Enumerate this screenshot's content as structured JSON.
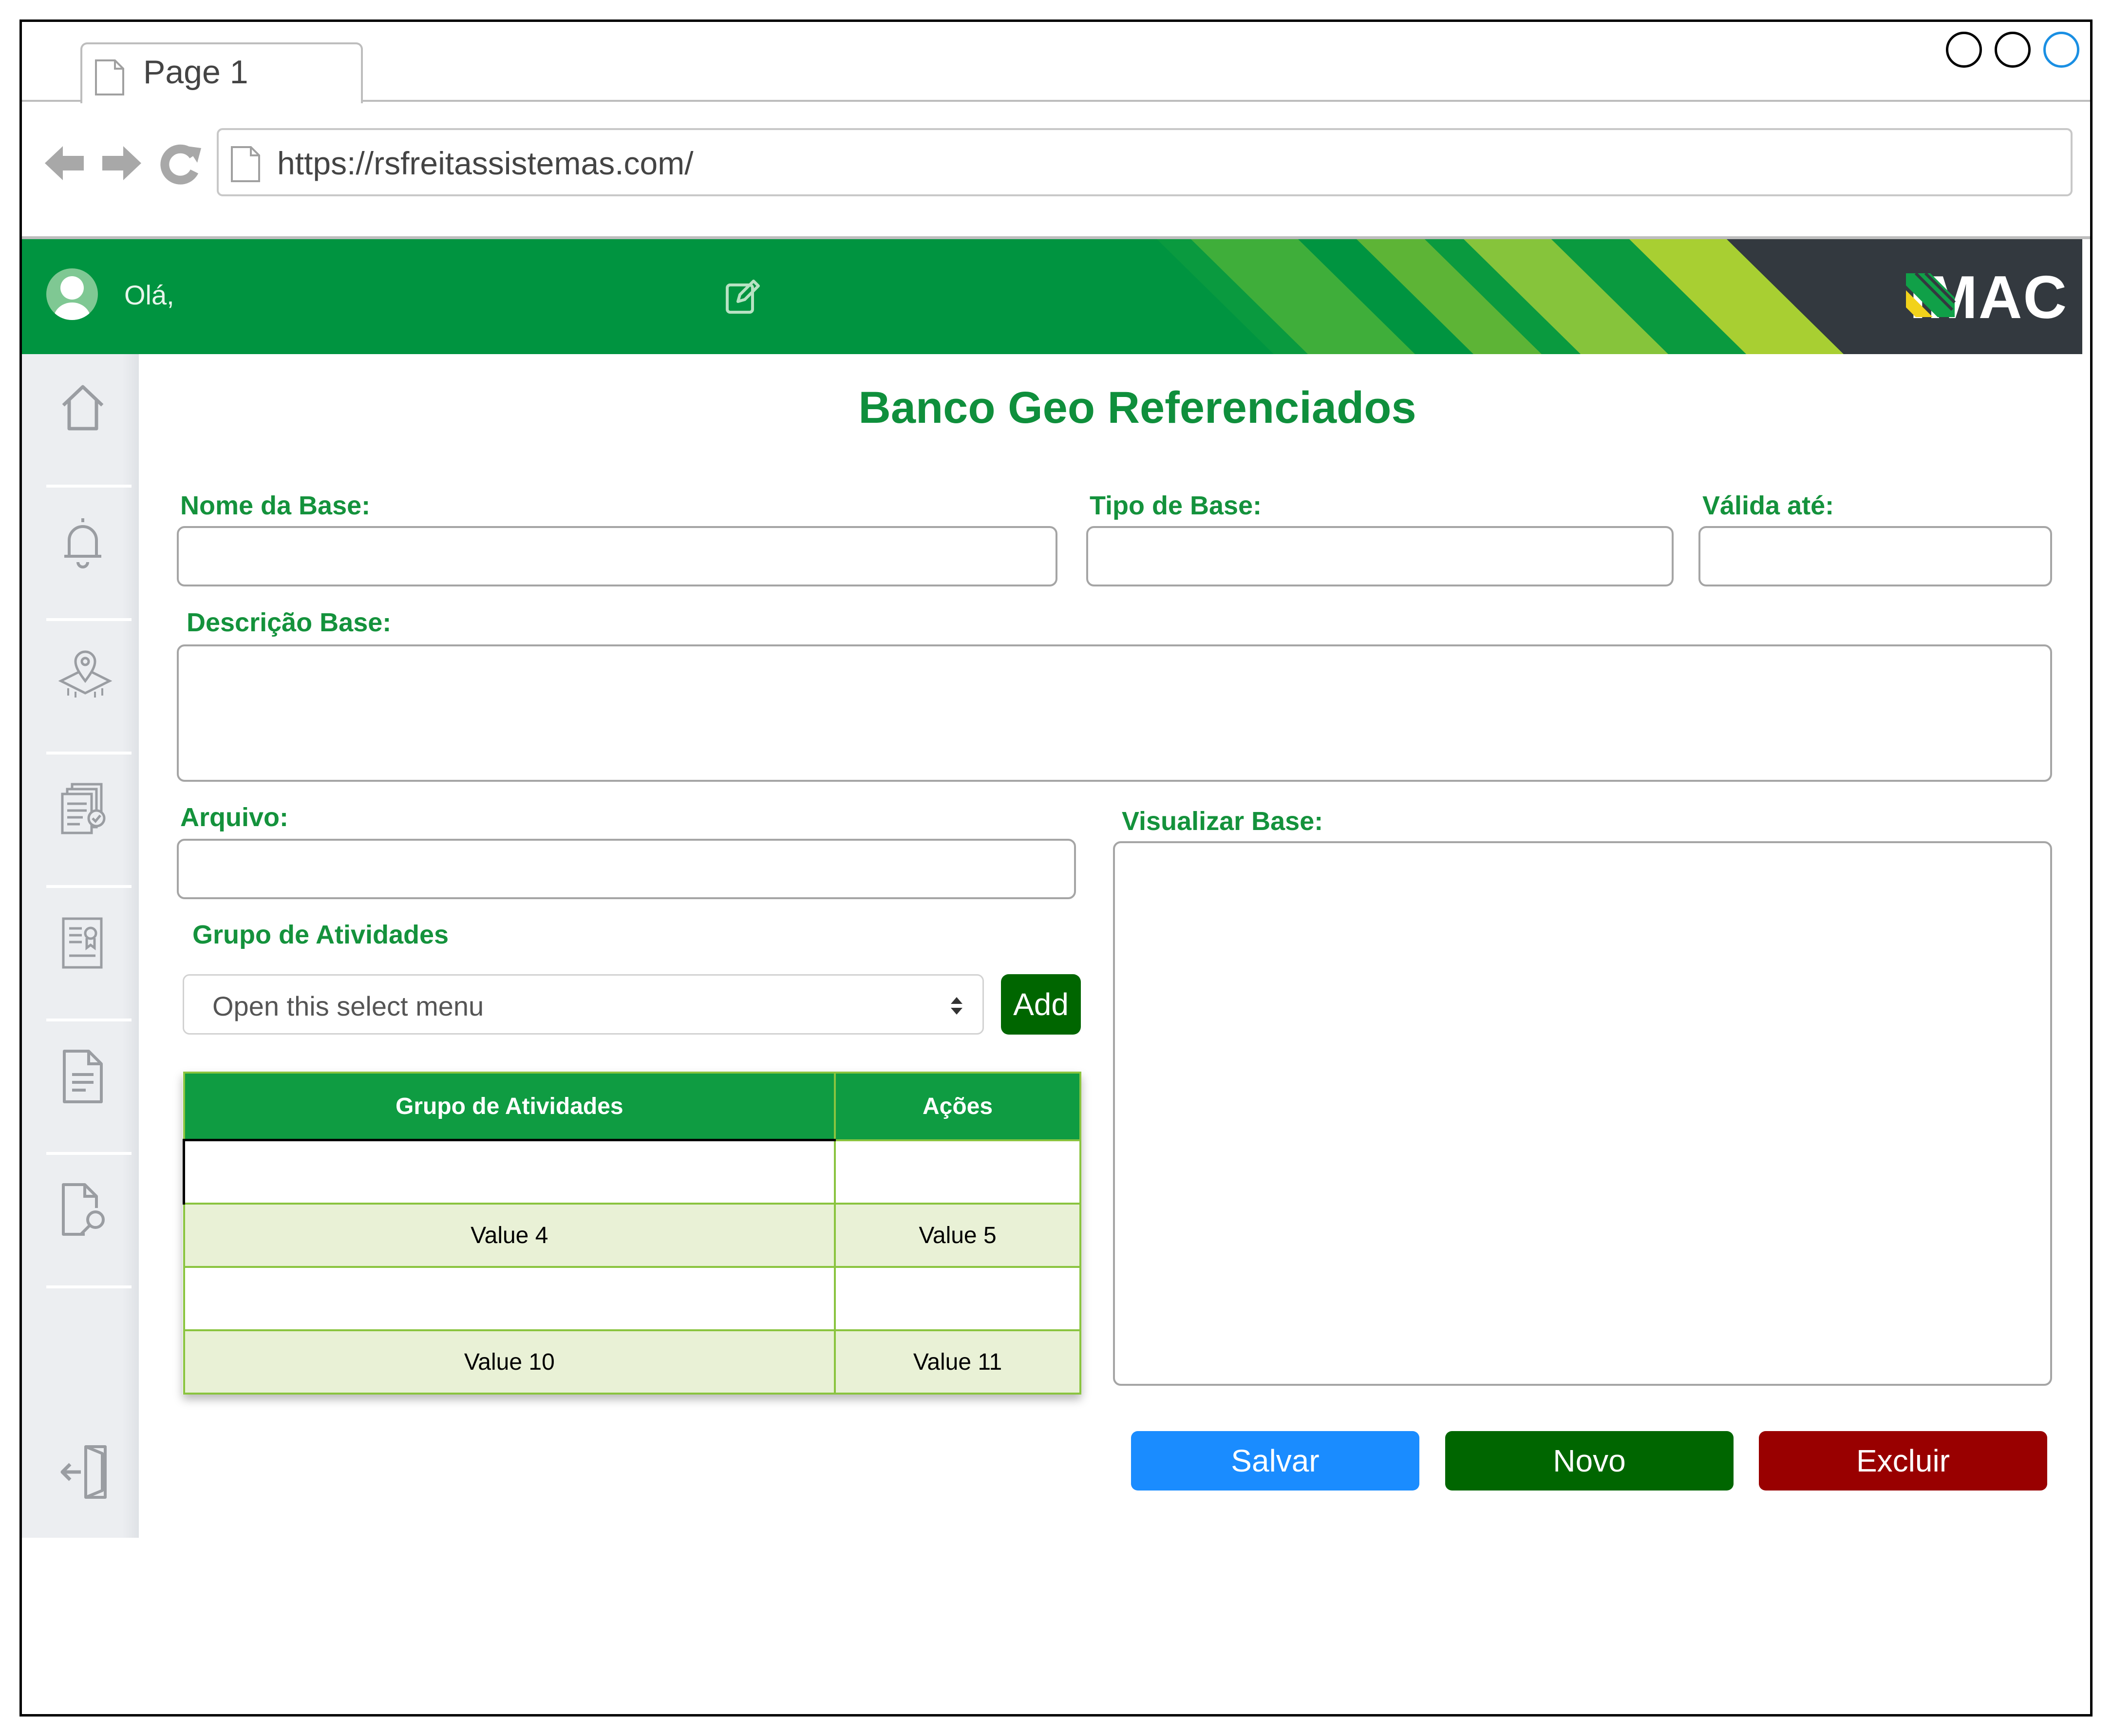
{
  "browser": {
    "tab_label": "Page 1",
    "url": "https://rsfreitassistemas.com/"
  },
  "header": {
    "greeting": "Olá,",
    "logo_text": "IMAC",
    "brand_color": "#009440"
  },
  "sidebar": {
    "items": [
      {
        "icon": "home-icon"
      },
      {
        "icon": "bell-icon"
      },
      {
        "icon": "map-pin-icon"
      },
      {
        "icon": "documents-check-icon"
      },
      {
        "icon": "certificate-icon"
      },
      {
        "icon": "document-icon"
      },
      {
        "icon": "document-search-icon"
      }
    ],
    "logout_icon": "logout-icon"
  },
  "page": {
    "title": "Banco Geo Referenciados"
  },
  "form": {
    "nome_label": "Nome da Base:",
    "tipo_label": "Tipo de Base:",
    "valida_label": "Válida até:",
    "descricao_label": "Descrição Base:",
    "arquivo_label": "Arquivo:",
    "visualizar_label": "Visualizar Base:",
    "grupo_label": "Grupo de Atividades",
    "select_placeholder": "Open this select menu",
    "add_label": "Add"
  },
  "table": {
    "headers": [
      "Grupo de Atividades",
      "Ações"
    ],
    "rows": [
      [
        "",
        ""
      ],
      [
        "Value 4",
        "Value 5"
      ],
      [
        "",
        ""
      ],
      [
        "Value 10",
        "Value 11"
      ]
    ]
  },
  "actions": {
    "save_label": "Salvar",
    "new_label": "Novo",
    "delete_label": "Excluir",
    "save_color": "#1a8cff",
    "new_color": "#006600",
    "delete_color": "#990000"
  }
}
